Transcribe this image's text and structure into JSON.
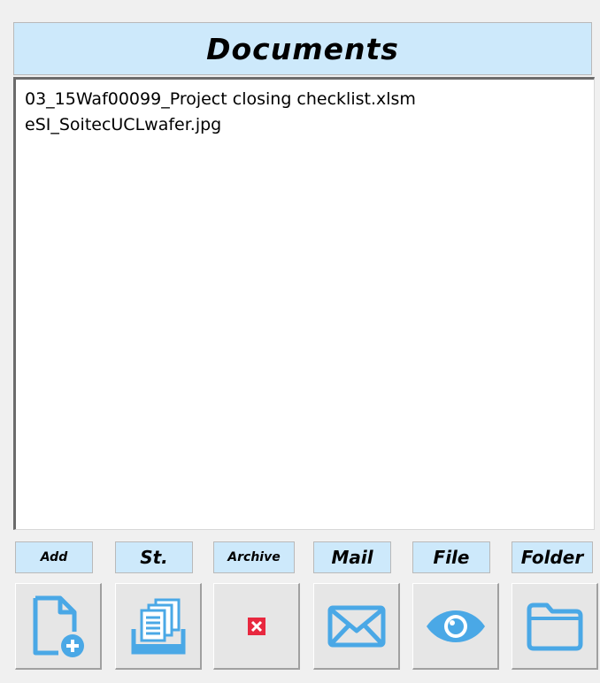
{
  "panel": {
    "title": "Documents"
  },
  "documents": [
    {
      "name": "03_15Waf00099_Project closing checklist.xlsm"
    },
    {
      "name": "eSI_SoitecUCLwafer.jpg"
    }
  ],
  "actions": [
    {
      "label": "Add",
      "icon": "add-file-icon"
    },
    {
      "label": "St.",
      "icon": "copy-stack-icon"
    },
    {
      "label": "Archive",
      "icon": "delete-x-icon"
    },
    {
      "label": "Mail",
      "icon": "envelope-icon"
    },
    {
      "label": "File",
      "icon": "eye-icon"
    },
    {
      "label": "Folder",
      "icon": "folder-icon"
    }
  ],
  "colors": {
    "accent": "#4aa8e6",
    "header_bg": "#cde9fb",
    "danger": "#e8283f"
  }
}
